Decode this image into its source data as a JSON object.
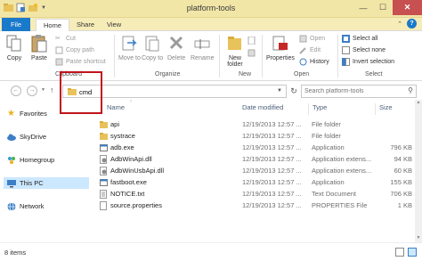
{
  "window": {
    "title": "platform-tools"
  },
  "tabs": [
    {
      "label": "File"
    },
    {
      "label": "Home"
    },
    {
      "label": "Share"
    },
    {
      "label": "View"
    }
  ],
  "ribbon": {
    "copy": "Copy",
    "paste": "Paste",
    "cut": "Cut",
    "copy_path": "Copy path",
    "paste_shortcut": "Paste shortcut",
    "clipboard_group": "Clipboard",
    "move_to": "Move to",
    "copy_to": "Copy to",
    "delete": "Delete",
    "rename": "Rename",
    "organize_group": "Organize",
    "new_folder": "New folder",
    "new_group": "New",
    "properties": "Properties",
    "open": "Open",
    "edit": "Edit",
    "history": "History",
    "open_group": "Open",
    "select_all": "Select all",
    "select_none": "Select none",
    "invert_selection": "Invert selection",
    "select_group": "Select"
  },
  "address": {
    "text": "cmd"
  },
  "search": {
    "placeholder": "Search platform-tools"
  },
  "nav": {
    "items": [
      {
        "label": "Favorites",
        "icon": "star-icon"
      },
      {
        "label": "SkyDrive",
        "icon": "cloud-icon"
      },
      {
        "label": "Homegroup",
        "icon": "homegroup-icon"
      },
      {
        "label": "This PC",
        "icon": "pc-icon"
      },
      {
        "label": "Network",
        "icon": "network-icon"
      }
    ]
  },
  "columns": {
    "name": "Name",
    "date": "Date modified",
    "type": "Type",
    "size": "Size"
  },
  "files": [
    {
      "name": "api",
      "date": "12/19/2013 12:57 ...",
      "type": "File folder",
      "size": "",
      "kind": "folder"
    },
    {
      "name": "systrace",
      "date": "12/19/2013 12:57 ...",
      "type": "File folder",
      "size": "",
      "kind": "folder"
    },
    {
      "name": "adb.exe",
      "date": "12/19/2013 12:57 ...",
      "type": "Application",
      "size": "796 KB",
      "kind": "exe"
    },
    {
      "name": "AdbWinApi.dll",
      "date": "12/19/2013 12:57 ...",
      "type": "Application extens...",
      "size": "94 KB",
      "kind": "dll"
    },
    {
      "name": "AdbWinUsbApi.dll",
      "date": "12/19/2013 12:57 ...",
      "type": "Application extens...",
      "size": "60 KB",
      "kind": "dll"
    },
    {
      "name": "fastboot.exe",
      "date": "12/19/2013 12:57 ...",
      "type": "Application",
      "size": "155 KB",
      "kind": "exe"
    },
    {
      "name": "NOTICE.txt",
      "date": "12/19/2013 12:57 ...",
      "type": "Text Document",
      "size": "706 KB",
      "kind": "txt"
    },
    {
      "name": "source.properties",
      "date": "12/19/2013 12:57 ...",
      "type": "PROPERTIES File",
      "size": "1 KB",
      "kind": "file"
    }
  ],
  "status": {
    "count": "8 items"
  },
  "colors": {
    "accent": "#1979ca",
    "titlebar": "#f2e6a7",
    "highlight": "#c0151c",
    "folder": "#e8c25a"
  }
}
